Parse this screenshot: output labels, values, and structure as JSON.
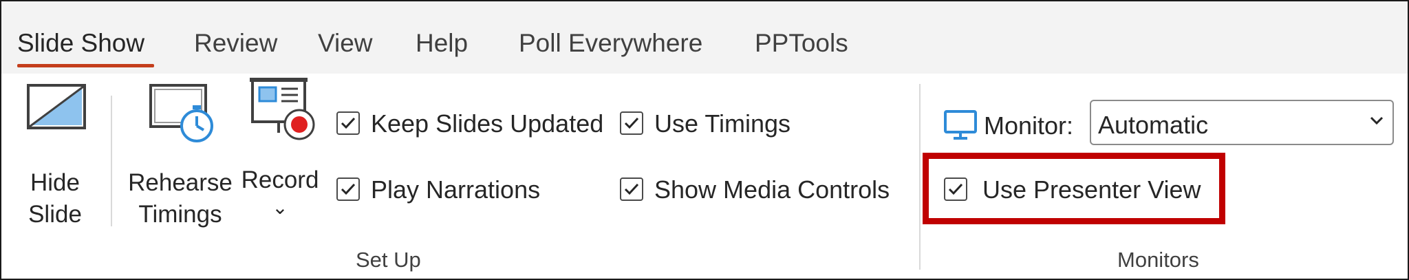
{
  "tabs": [
    {
      "label": "Slide Show",
      "active": true
    },
    {
      "label": "Review"
    },
    {
      "label": "View"
    },
    {
      "label": "Help"
    },
    {
      "label": "Poll Everywhere"
    },
    {
      "label": "PPTools"
    }
  ],
  "buttons": {
    "hide_slide": {
      "line1": "Hide",
      "line2": "Slide"
    },
    "rehearse_timings": {
      "line1": "Rehearse",
      "line2": "Timings"
    },
    "record": {
      "label": "Record",
      "chevron": "⌄"
    }
  },
  "checkboxes": {
    "keep_slides_updated": {
      "label": "Keep Slides Updated",
      "checked": true
    },
    "play_narrations": {
      "label": "Play Narrations",
      "checked": true
    },
    "use_timings": {
      "label": "Use Timings",
      "checked": true
    },
    "show_media_controls": {
      "label": "Show Media Controls",
      "checked": true
    },
    "use_presenter_view": {
      "label": "Use Presenter View",
      "checked": true
    }
  },
  "monitor": {
    "label": "Monitor:",
    "value": "Automatic"
  },
  "groups": {
    "setup": "Set Up",
    "monitors": "Monitors"
  },
  "colors": {
    "accent": "#c43e1c",
    "highlight": "#c00000",
    "icon_blue": "#2e8bd8"
  }
}
